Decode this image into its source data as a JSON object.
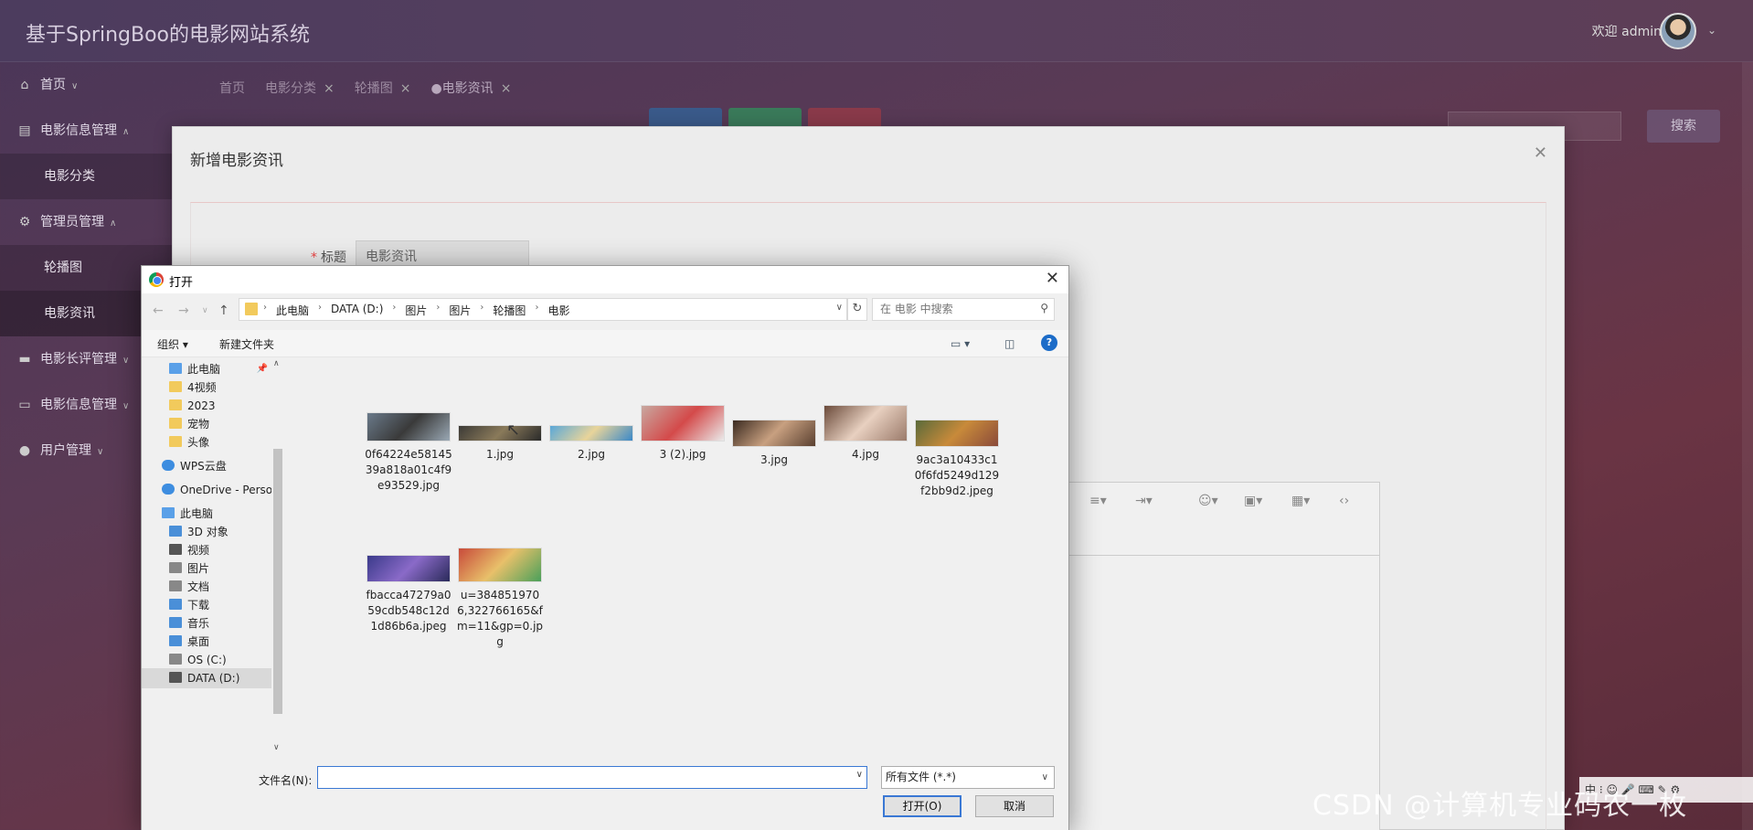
{
  "app": {
    "title": "基于SpringBoo的电影网站系统",
    "welcome": "欢迎 admin"
  },
  "sidebar": {
    "items": [
      {
        "label": "首页",
        "icon": "home-icon"
      },
      {
        "label": "电影信息管理",
        "icon": "film-icon"
      },
      {
        "label": "电影分类",
        "sub": true
      },
      {
        "label": "管理员管理",
        "icon": "gear-icon"
      },
      {
        "label": "轮播图",
        "sub": true
      },
      {
        "label": "电影资讯",
        "sub": true,
        "active": true
      },
      {
        "label": "电影长评管理",
        "icon": "list-icon"
      },
      {
        "label": "电影信息管理",
        "icon": "monitor-icon"
      },
      {
        "label": "用户管理",
        "icon": "user-icon"
      }
    ]
  },
  "tabs": [
    {
      "label": "首页"
    },
    {
      "label": "电影分类"
    },
    {
      "label": "轮播图"
    },
    {
      "label": "●电影资讯"
    }
  ],
  "search_button": "搜索",
  "modal": {
    "title": "新增电影资讯",
    "field_label": "标题",
    "field_value": "电影资讯"
  },
  "dialog": {
    "title": "打开",
    "breadcrumb": [
      "此电脑",
      "DATA (D:)",
      "图片",
      "图片",
      "轮播图",
      "电影"
    ],
    "search_placeholder": "在 电影 中搜索",
    "organize": "组织 ▾",
    "new_folder": "新建文件夹",
    "nav": [
      {
        "label": "此电脑",
        "icon": "f-pc"
      },
      {
        "label": "4视频",
        "icon": "f-yel"
      },
      {
        "label": "2023",
        "icon": "f-yel"
      },
      {
        "label": "宠物",
        "icon": "f-yel"
      },
      {
        "label": "头像",
        "icon": "f-yel"
      },
      {
        "label": "WPS云盘",
        "icon": "f-cloud"
      },
      {
        "label": "OneDrive - Perso",
        "icon": "f-cloud"
      },
      {
        "label": "此电脑",
        "icon": "f-pc"
      },
      {
        "label": "3D 对象",
        "icon": "f-blue"
      },
      {
        "label": "视频",
        "icon": "f-dark"
      },
      {
        "label": "图片",
        "icon": "f-grey"
      },
      {
        "label": "文档",
        "icon": "f-grey"
      },
      {
        "label": "下载",
        "icon": "f-blue"
      },
      {
        "label": "音乐",
        "icon": "f-blue"
      },
      {
        "label": "桌面",
        "icon": "f-blue"
      },
      {
        "label": "OS (C:)",
        "icon": "f-grey"
      },
      {
        "label": "DATA (D:)",
        "icon": "f-dark",
        "selected": true
      }
    ],
    "files": [
      {
        "name": "0f64224e5814539a818a01c4f9e93529.jpg",
        "colors": [
          "#6a7a8a",
          "#3a3a3a",
          "#9aa8b4"
        ]
      },
      {
        "name": "1.jpg",
        "colors": [
          "#3c3a36",
          "#8a7a5a",
          "#2a2a2a"
        ]
      },
      {
        "name": "2.jpg",
        "colors": [
          "#5aa8d8",
          "#e8d49a",
          "#3a88c8"
        ]
      },
      {
        "name": "3 (2).jpg",
        "colors": [
          "#c8a8a0",
          "#d44a4a",
          "#eaeaea"
        ]
      },
      {
        "name": "3.jpg",
        "colors": [
          "#3a2a20",
          "#c8a080",
          "#5a4030"
        ]
      },
      {
        "name": "4.jpg",
        "colors": [
          "#6a4a3a",
          "#e8d0c0",
          "#9a7a6a"
        ]
      },
      {
        "name": "9ac3a10433c10f6fd5249d129f2bb9d2.jpeg",
        "colors": [
          "#5a6a3a",
          "#c88a3a",
          "#8a4a3a"
        ]
      },
      {
        "name": "fbacca47279a059cdb548c12d1d86b6a.jpeg",
        "colors": [
          "#3a3a8a",
          "#8a6ac8",
          "#2a2a5a"
        ]
      },
      {
        "name": "u=3848519706,322766165&fm=11&gp=0.jpg",
        "colors": [
          "#c84a3a",
          "#e8c06a",
          "#4aa05a"
        ]
      }
    ],
    "filename_label": "文件名(N):",
    "filename_value": "",
    "filetype": "所有文件 (*.*)",
    "open_button": "打开(O)",
    "cancel_button": "取消"
  },
  "watermark": "CSDN @计算机专业码农一枚"
}
